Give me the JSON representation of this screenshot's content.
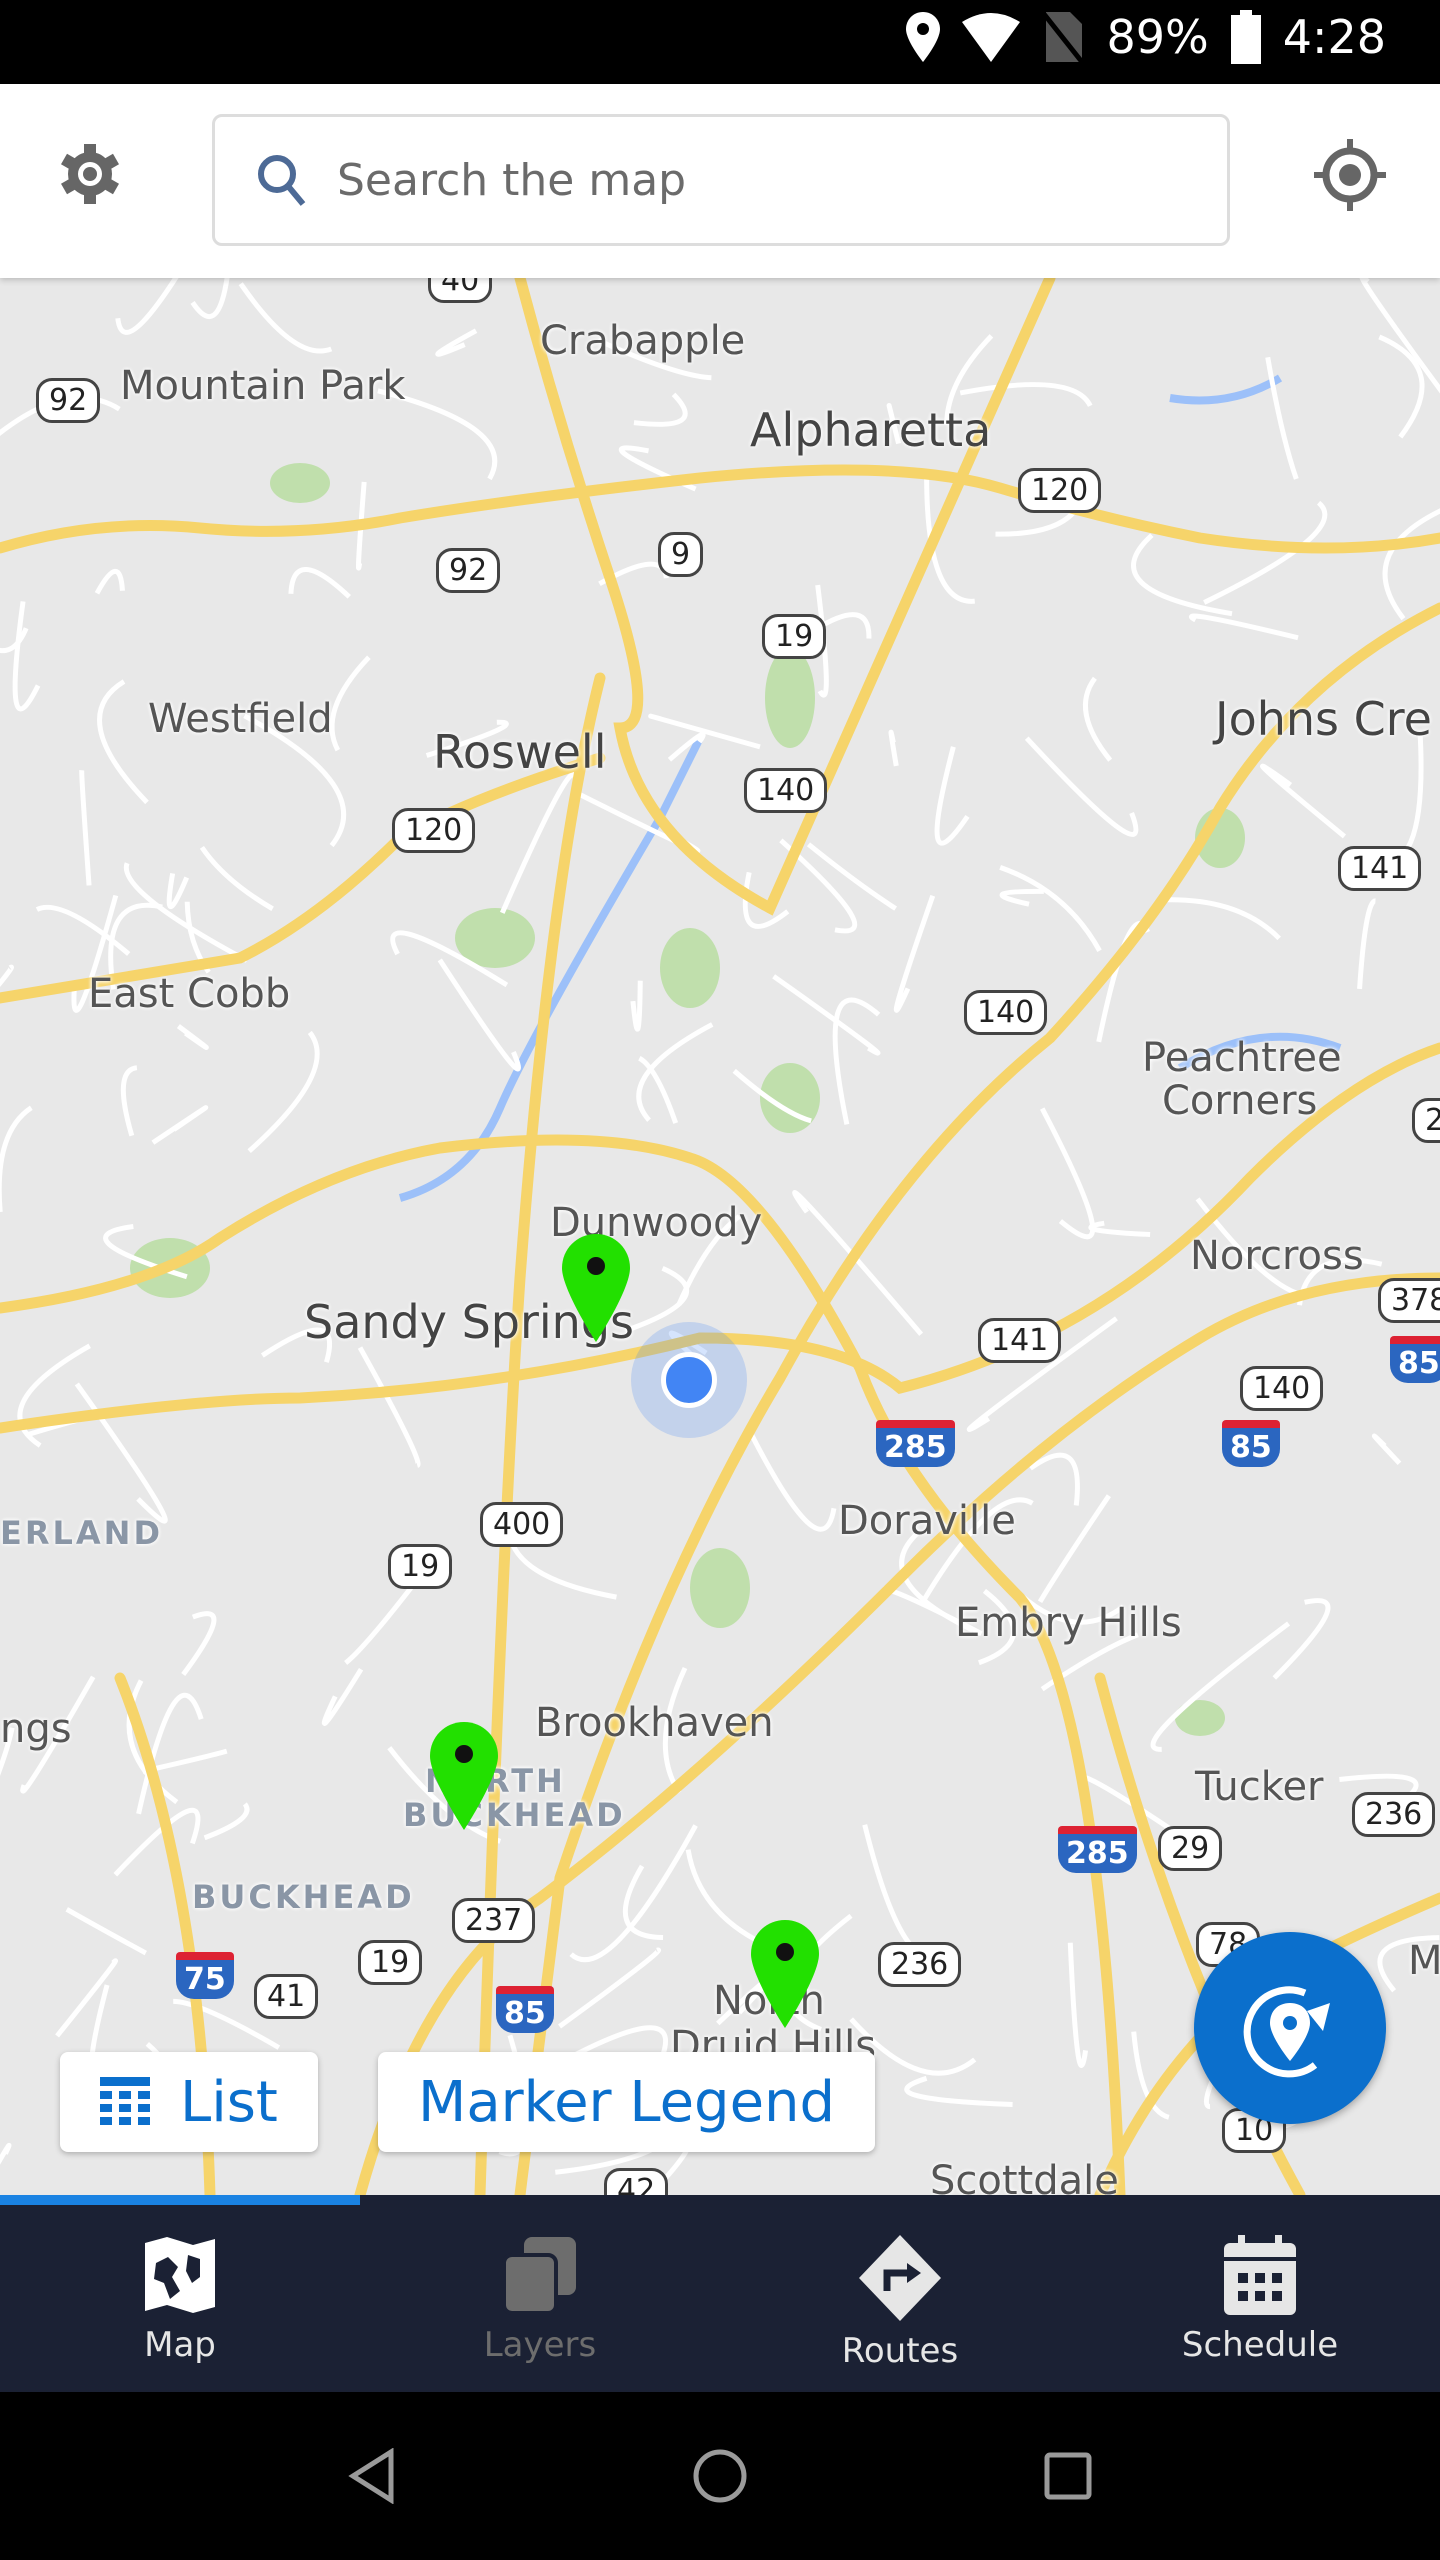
{
  "status_bar": {
    "battery": "89%",
    "time": "4:28",
    "icons": [
      "location-icon",
      "wifi-icon",
      "no-sim-icon",
      "battery-icon"
    ]
  },
  "header": {
    "settings_icon": "gear-icon",
    "search_placeholder": "Search the map",
    "locate_icon": "crosshair-icon"
  },
  "map": {
    "places": [
      "Crabapple",
      "Mountain Park",
      "Alpharetta",
      "Westfield",
      "Roswell",
      "Johns Cre",
      "East Cobb",
      "Peachtree",
      "Corners",
      "Dunwoody",
      "Sandy Springs",
      "Norcross",
      "Doraville",
      "Embry Hills",
      "Brookhaven",
      "Tucker",
      "North",
      "Druid Hills",
      "Scottdale",
      "ERLAND",
      "ngs",
      "BUCKHEAD",
      "NORTH",
      "BUCKHEAD",
      "M"
    ],
    "route_shields": [
      "92",
      "92",
      "9",
      "19",
      "120",
      "120",
      "140",
      "140",
      "141",
      "141",
      "140",
      "400",
      "19",
      "237",
      "19",
      "41",
      "236",
      "236",
      "29",
      "78",
      "10",
      "42",
      "378",
      "2",
      "40"
    ],
    "interstate_shields": [
      "285",
      "285",
      "85",
      "85",
      "75",
      "85"
    ],
    "markers": [
      {
        "color": "#22e000"
      },
      {
        "color": "#22e000"
      },
      {
        "color": "#22e000"
      }
    ],
    "current_location_color": "#4285f4"
  },
  "buttons": {
    "list": "List",
    "marker_legend": "Marker Legend",
    "fab_icon": "route-optimize-icon"
  },
  "tab_progress_percent": 25,
  "nav": {
    "tabs": [
      {
        "label": "Map",
        "active": true
      },
      {
        "label": "Layers",
        "active": false
      },
      {
        "label": "Routes",
        "active": false
      },
      {
        "label": "Schedule",
        "active": false
      }
    ]
  },
  "colors": {
    "accent": "#0b6fcc",
    "nav_bg": "#1b2134",
    "marker": "#22e000"
  }
}
